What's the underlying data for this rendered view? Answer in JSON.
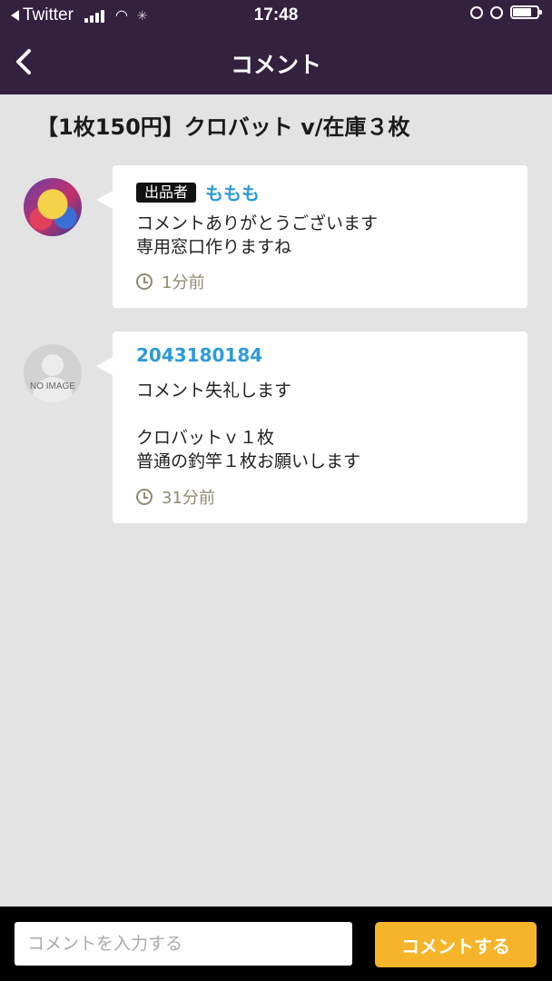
{
  "status_bar": {
    "back_app": "Twitter",
    "time": "17:48",
    "battery_level": 0.75
  },
  "nav": {
    "title": "コメント",
    "back_icon": "chevron-left-icon"
  },
  "item": {
    "title": "【1枚150円】クロバット v/在庫３枚"
  },
  "comments": [
    {
      "badge": "出品者",
      "user": "ももも",
      "message": "コメントありがとうございます\n専用窓口作りますね",
      "time": "1分前"
    },
    {
      "user": "2043180184",
      "avatar_label": "NO IMAGE",
      "message": "コメント失礼します\n\nクロバットｖ１枚\n普通の釣竿１枚お願いします",
      "time": "31分前"
    }
  ],
  "composer": {
    "placeholder": "コメントを入力する",
    "value": "",
    "send_label": "コメントする"
  },
  "colors": {
    "header": "#34203f",
    "accent": "#f6b42a",
    "username": "#2d9bd9",
    "background": "#e3e3e3"
  }
}
